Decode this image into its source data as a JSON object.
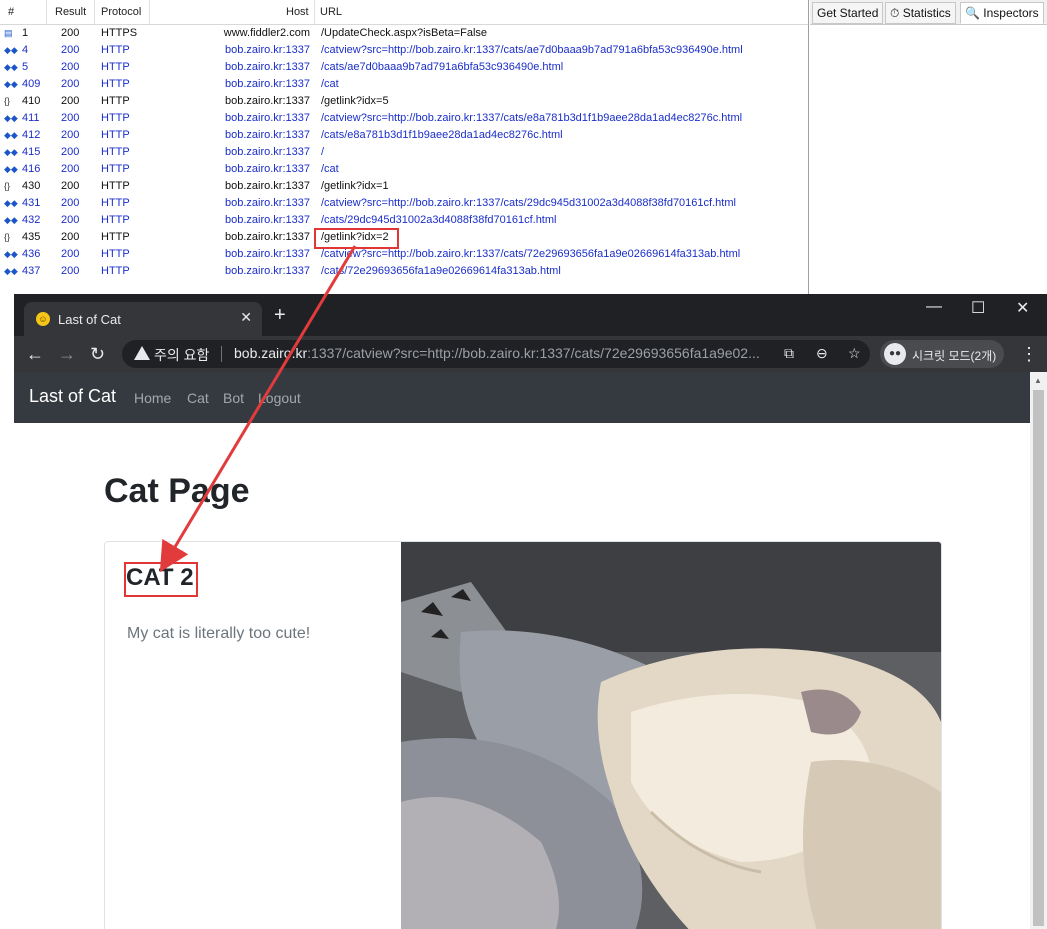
{
  "fiddler": {
    "columns": [
      "#",
      "Result",
      "Protocol",
      "Host",
      "URL"
    ],
    "sessions": [
      {
        "id": "1",
        "result": "200",
        "protocol": "HTTPS",
        "host": "www.fiddler2.com",
        "url": "/UpdateCheck.aspx?isBeta=False",
        "icon": "document-icon"
      },
      {
        "id": "4",
        "result": "200",
        "protocol": "HTTP",
        "host": "bob.zairo.kr:1337",
        "url": "/catview?src=http://bob.zairo.kr:1337/cats/ae7d0baaa9b7ad791a6bfa53c936490e.html",
        "icon": "html-icon"
      },
      {
        "id": "5",
        "result": "200",
        "protocol": "HTTP",
        "host": "bob.zairo.kr:1337",
        "url": "/cats/ae7d0baaa9b7ad791a6bfa53c936490e.html",
        "icon": "html-icon"
      },
      {
        "id": "409",
        "result": "200",
        "protocol": "HTTP",
        "host": "bob.zairo.kr:1337",
        "url": "/cat",
        "icon": "html-icon"
      },
      {
        "id": "410",
        "result": "200",
        "protocol": "HTTP",
        "host": "bob.zairo.kr:1337",
        "url": "/getlink?idx=5",
        "icon": "json-icon"
      },
      {
        "id": "411",
        "result": "200",
        "protocol": "HTTP",
        "host": "bob.zairo.kr:1337",
        "url": "/catview?src=http://bob.zairo.kr:1337/cats/e8a781b3d1f1b9aee28da1ad4ec8276c.html",
        "icon": "html-icon"
      },
      {
        "id": "412",
        "result": "200",
        "protocol": "HTTP",
        "host": "bob.zairo.kr:1337",
        "url": "/cats/e8a781b3d1f1b9aee28da1ad4ec8276c.html",
        "icon": "html-icon"
      },
      {
        "id": "415",
        "result": "200",
        "protocol": "HTTP",
        "host": "bob.zairo.kr:1337",
        "url": "/",
        "icon": "html-icon"
      },
      {
        "id": "416",
        "result": "200",
        "protocol": "HTTP",
        "host": "bob.zairo.kr:1337",
        "url": "/cat",
        "icon": "html-icon"
      },
      {
        "id": "430",
        "result": "200",
        "protocol": "HTTP",
        "host": "bob.zairo.kr:1337",
        "url": "/getlink?idx=1",
        "icon": "json-icon"
      },
      {
        "id": "431",
        "result": "200",
        "protocol": "HTTP",
        "host": "bob.zairo.kr:1337",
        "url": "/catview?src=http://bob.zairo.kr:1337/cats/29dc945d31002a3d4088f38fd70161cf.html",
        "icon": "html-icon"
      },
      {
        "id": "432",
        "result": "200",
        "protocol": "HTTP",
        "host": "bob.zairo.kr:1337",
        "url": "/cats/29dc945d31002a3d4088f38fd70161cf.html",
        "icon": "html-icon"
      },
      {
        "id": "435",
        "result": "200",
        "protocol": "HTTP",
        "host": "bob.zairo.kr:1337",
        "url": "/getlink?idx=2",
        "icon": "json-icon"
      },
      {
        "id": "436",
        "result": "200",
        "protocol": "HTTP",
        "host": "bob.zairo.kr:1337",
        "url": "/catview?src=http://bob.zairo.kr:1337/cats/72e29693656fa1a9e02669614fa313ab.html",
        "icon": "html-icon"
      },
      {
        "id": "437",
        "result": "200",
        "protocol": "HTTP",
        "host": "bob.zairo.kr:1337",
        "url": "/cats/72e29693656fa1a9e02669614fa313ab.html",
        "icon": "html-icon"
      }
    ],
    "tabs": [
      {
        "label": "Get Started",
        "icon": ""
      },
      {
        "label": "Statistics",
        "icon": "stopwatch-icon"
      },
      {
        "label": "Inspectors",
        "icon": "inspector-icon"
      }
    ],
    "colors": {
      "link_row": "#1a2ec9",
      "plain_row": "#111111",
      "highlight": "#e03636"
    }
  },
  "browser": {
    "tab_title": "Last of Cat",
    "tab_close": "✕",
    "new_tab": "+",
    "window_controls": {
      "minimize": "—",
      "maximize": "☐",
      "close": "✕"
    },
    "security_label": "주의 요함",
    "url_host": "bob.zairo.kr",
    "url_rest": ":1337/catview?src=http://bob.zairo.kr:1337/cats/72e29693656fa1a9e02...",
    "incognito_label": "시크릿 모드(2개)",
    "icons": [
      "back-icon",
      "forward-icon",
      "reload-icon",
      "translate-icon",
      "zoom-icon",
      "bookmark-star-icon",
      "incognito-icon",
      "menu-kebab-icon"
    ]
  },
  "site": {
    "brand": "Last of Cat",
    "nav": [
      "Home",
      "Cat",
      "Bot",
      "Logout"
    ],
    "page_title": "Cat Page",
    "card_title": "CAT 2",
    "card_text": "My cat is literally too cute!"
  }
}
